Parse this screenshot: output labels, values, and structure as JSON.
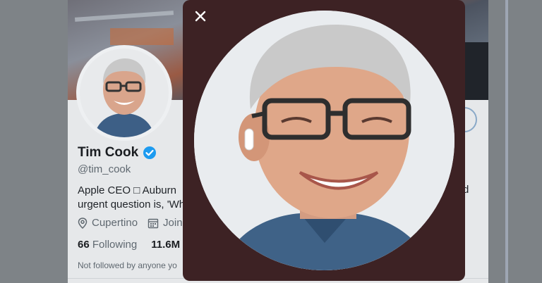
{
  "profile": {
    "name": "Tim Cook",
    "handle": "@tim_cook",
    "bio_line1": "Apple CEO □ Auburn",
    "bio_line2": "urgent question is, 'Wh",
    "bio_right_fragment": "d",
    "location": "Cupertino",
    "joined_fragment": "Joine",
    "following_count": "66",
    "following_label": "Following",
    "followers_count": "11.6M",
    "not_followed": "Not followed by anyone yo"
  },
  "modal": {
    "close_label": "✕"
  },
  "colors": {
    "modal_bg": "#3d2224",
    "verified_blue": "#1d9bf0",
    "page_bg": "#e6e8ea"
  },
  "icons": [
    "close-icon",
    "verified-badge-icon",
    "location-pin-icon",
    "calendar-icon"
  ]
}
